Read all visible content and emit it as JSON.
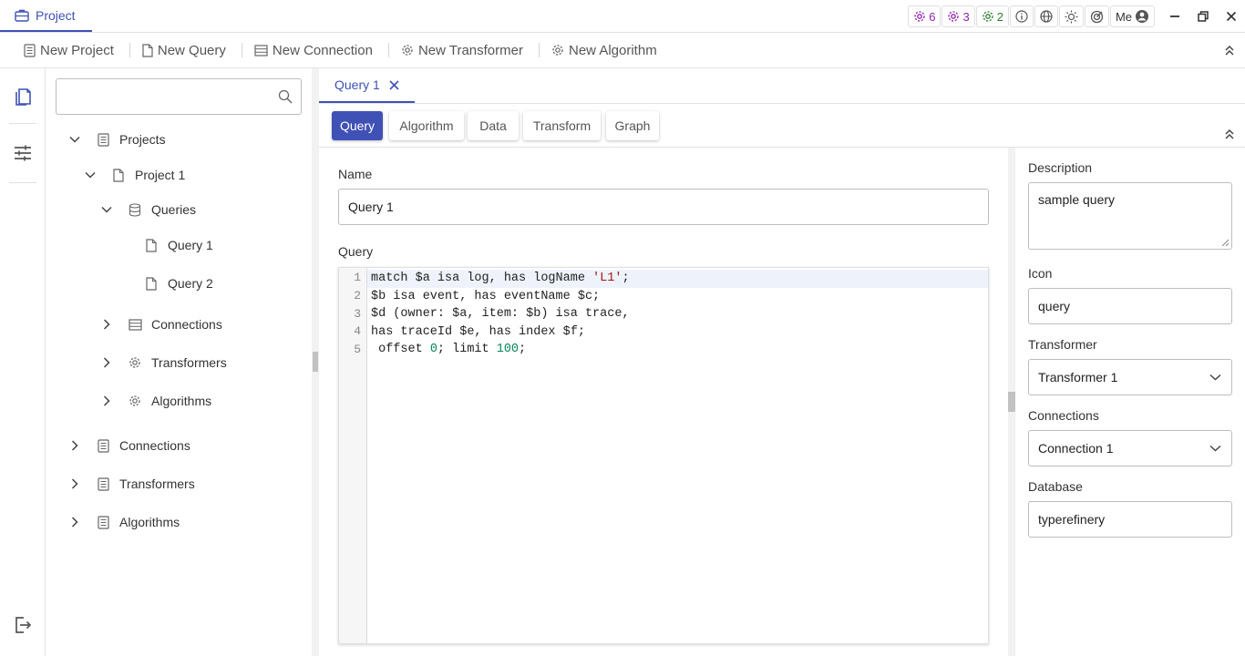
{
  "titlebar": {
    "app_tab": "Project",
    "chips": [
      {
        "count": "6",
        "color": "#8e24aa"
      },
      {
        "count": "3",
        "color": "#8e24aa"
      },
      {
        "count": "2",
        "color": "#2e7d32"
      }
    ],
    "user_label": "Me"
  },
  "toolbar": {
    "new_project": "New Project",
    "new_query": "New Query",
    "new_connection": "New Connection",
    "new_transformer": "New Transformer",
    "new_algorithm": "New Algorithm"
  },
  "search": {
    "placeholder": "",
    "value": ""
  },
  "tree": {
    "projects": "Projects",
    "project_1": "Project 1",
    "queries": "Queries",
    "query_1": "Query 1",
    "query_2": "Query 2",
    "connections_sub": "Connections",
    "transformers_sub": "Transformers",
    "algorithms_sub": "Algorithms",
    "connections": "Connections",
    "transformers": "Transformers",
    "algorithms": "Algorithms"
  },
  "doc_tab": {
    "label": "Query 1"
  },
  "subtabs": {
    "query": "Query",
    "algorithm": "Algorithm",
    "data": "Data",
    "transform": "Transform",
    "graph": "Graph"
  },
  "form": {
    "name_label": "Name",
    "name_value": "Query 1",
    "query_label": "Query",
    "code_lines": {
      "l1_pre": "match $a isa log, has logName ",
      "l1_str": "'L1'",
      "l1_post": ";",
      "l2": "$b isa event, has eventName $c;",
      "l3": "$d (owner: $a, item: $b) isa trace,",
      "l4": "has traceId $e, has index $f;",
      "l5_pre": " offset ",
      "l5_n1": "0",
      "l5_mid": "; limit ",
      "l5_n2": "100",
      "l5_post": ";"
    },
    "line_numbers": [
      "1",
      "2",
      "3",
      "4",
      "5"
    ]
  },
  "side": {
    "description_label": "Description",
    "description_value": "sample query",
    "icon_label": "Icon",
    "icon_value": "query",
    "transformer_label": "Transformer",
    "transformer_value": "Transformer 1",
    "connections_label": "Connections",
    "connections_value": "Connection 1",
    "database_label": "Database",
    "database_value": "typerefinery"
  },
  "colors": {
    "accent": "#3f51b5"
  }
}
